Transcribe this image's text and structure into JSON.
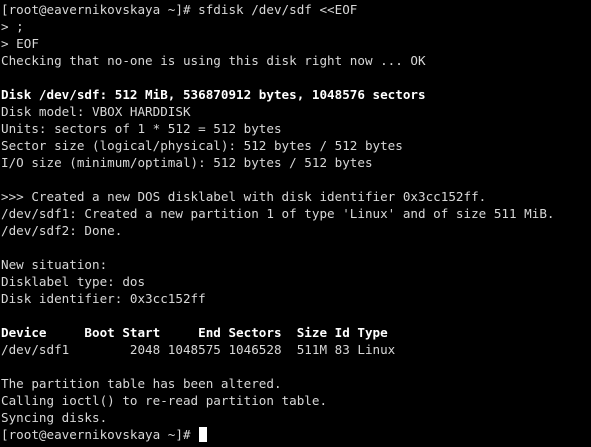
{
  "terminal": {
    "command_prompt": "[root@eavernikovskaya ~]# ",
    "command": "sfdisk /dev/sdf <<EOF",
    "heredoc_line1": "> ;",
    "heredoc_line2": "> EOF",
    "check_line": "Checking that no-one is using this disk right now ... OK",
    "disk_header": "Disk /dev/sdf: 512 MiB, 536870912 bytes, 1048576 sectors",
    "disk_model": "Disk model: VBOX HARDDISK",
    "units": "Units: sectors of 1 * 512 = 512 bytes",
    "sector_size": "Sector size (logical/physical): 512 bytes / 512 bytes",
    "io_size": "I/O size (minimum/optimal): 512 bytes / 512 bytes",
    "created_label": ">>> Created a new DOS disklabel with disk identifier 0x3cc152ff.",
    "created_partition": "/dev/sdf1: Created a new partition 1 of type 'Linux' and of size 511 MiB.",
    "sdf2_done": "/dev/sdf2: Done.",
    "new_situation": "New situation:",
    "disklabel_type": "Disklabel type: dos",
    "disk_identifier": "Disk identifier: 0x3cc152ff",
    "table_header": "Device     Boot Start     End Sectors  Size Id Type",
    "table_row": "/dev/sdf1        2048 1048575 1046528  511M 83 Linux",
    "altered": "The partition table has been altered.",
    "ioctl": "Calling ioctl() to re-read partition table.",
    "syncing": "Syncing disks.",
    "final_prompt": "[root@eavernikovskaya ~]# "
  }
}
